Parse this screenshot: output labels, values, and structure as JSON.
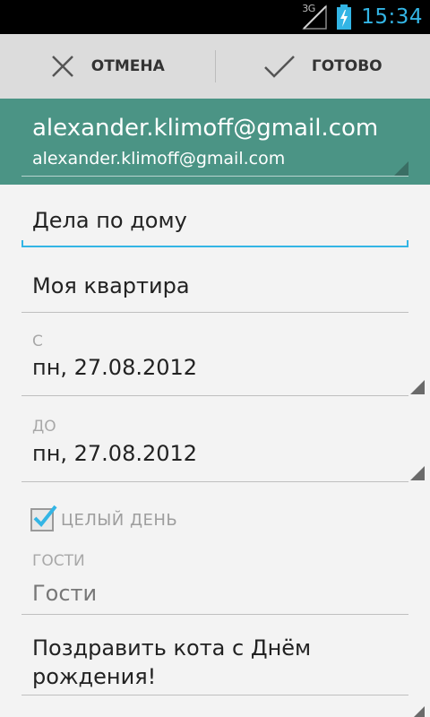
{
  "status_bar": {
    "network": "3G",
    "time": "15:34",
    "time_color": "#33b5e5"
  },
  "action_bar": {
    "cancel_label": "ОТМЕНА",
    "done_label": "ГОТОВО"
  },
  "account": {
    "name": "alexander.klimoff@gmail.com",
    "email": "alexander.klimoff@gmail.com",
    "background_color": "#4b9485"
  },
  "form": {
    "title_value": "Дела по дому",
    "location_value": "Моя квартира",
    "from_label": "С",
    "from_date": "пн, 27.08.2012",
    "to_label": "ДО",
    "to_date": "пн, 27.08.2012",
    "all_day_label": "ЦЕЛЫЙ ДЕНЬ",
    "all_day_checked": true,
    "guests_label": "ГОСТИ",
    "guests_placeholder": "Гости",
    "description_value": "Поздравить кота с Днём рождения!"
  },
  "icons": {
    "cancel": "close-icon",
    "done": "check-icon",
    "signal": "signal-icon",
    "battery": "battery-charging-icon"
  }
}
